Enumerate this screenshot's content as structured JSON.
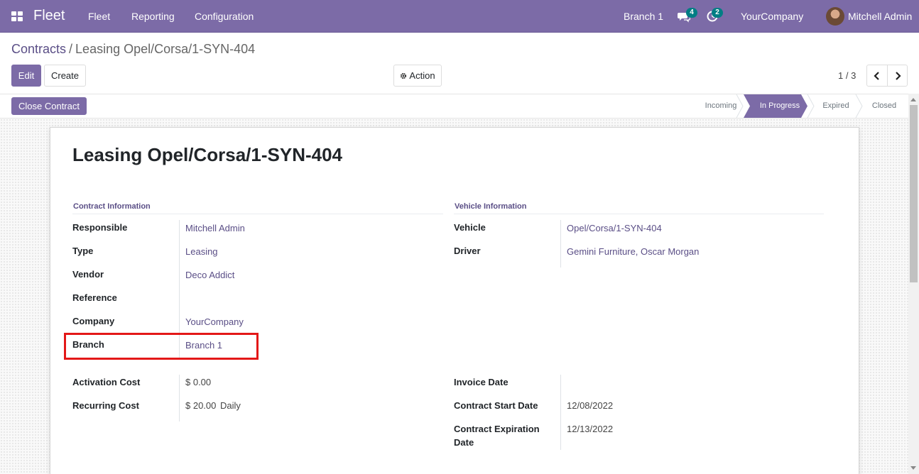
{
  "navbar": {
    "app_name": "Fleet",
    "menu": [
      "Fleet",
      "Reporting",
      "Configuration"
    ],
    "branch": "Branch 1",
    "messages_count": "4",
    "activities_count": "2",
    "company": "YourCompany",
    "user": "Mitchell Admin"
  },
  "breadcrumb": {
    "parent": "Contracts",
    "separator": "/",
    "current": "Leasing Opel/Corsa/1-SYN-404"
  },
  "toolbar": {
    "edit_label": "Edit",
    "create_label": "Create",
    "action_label": "Action",
    "pager": "1 / 3"
  },
  "statusbar": {
    "close_contract_label": "Close Contract",
    "stages": [
      "Incoming",
      "In Progress",
      "Expired",
      "Closed"
    ],
    "active_stage": "In Progress"
  },
  "form": {
    "title": "Leasing Opel/Corsa/1-SYN-404",
    "contract_group_title": "Contract Information",
    "vehicle_group_title": "Vehicle Information",
    "contract": {
      "responsible_label": "Responsible",
      "responsible": "Mitchell Admin",
      "type_label": "Type",
      "type": "Leasing",
      "vendor_label": "Vendor",
      "vendor": "Deco Addict",
      "reference_label": "Reference",
      "reference": "",
      "company_label": "Company",
      "company": "YourCompany",
      "branch_label": "Branch",
      "branch": "Branch 1"
    },
    "vehicle": {
      "vehicle_label": "Vehicle",
      "vehicle": "Opel/Corsa/1-SYN-404",
      "driver_label": "Driver",
      "driver": "Gemini Furniture, Oscar Morgan"
    },
    "costs": {
      "activation_cost_label": "Activation Cost",
      "activation_cost": "$ 0.00",
      "recurring_cost_label": "Recurring Cost",
      "recurring_cost": "$ 20.00",
      "recurring_period": "Daily"
    },
    "dates": {
      "invoice_date_label": "Invoice Date",
      "invoice_date": "",
      "start_date_label": "Contract Start Date",
      "start_date": "12/08/2022",
      "expiration_label_line1": "Contract Expiration",
      "expiration_label_line2": "Date",
      "expiration_date": "12/13/2022"
    }
  },
  "colors": {
    "brand": "#7c6ba7",
    "highlight_box": "#e31818",
    "badge": "#017e84"
  }
}
